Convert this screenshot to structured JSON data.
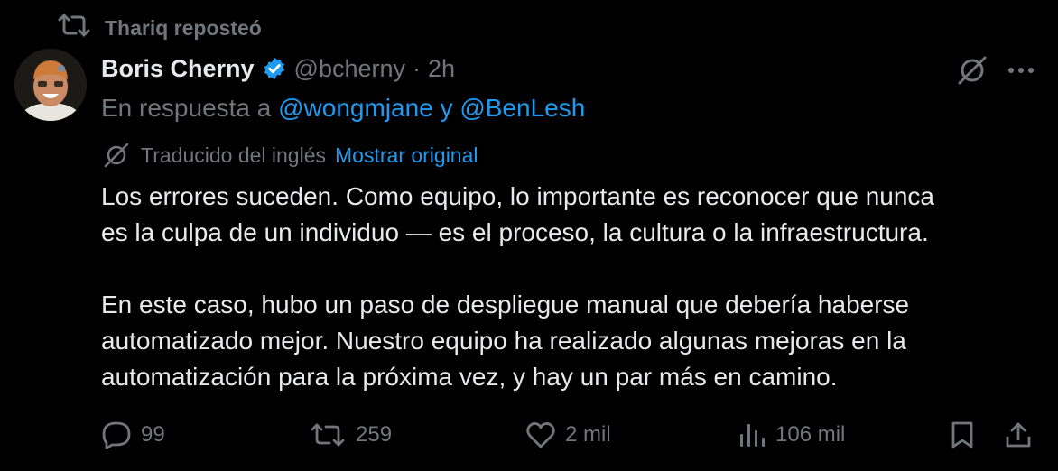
{
  "repost": {
    "label": "Thariq reposteó",
    "icon": "retweet-icon"
  },
  "author": {
    "name": "Boris Cherny",
    "verified": true,
    "verified_color": "#1d9bf0",
    "handle": "@bcherny",
    "separator": "·",
    "time": "2h"
  },
  "reply_to": {
    "prefix": "En respuesta a",
    "mention1": "@wongmjane",
    "conjunction": "y",
    "mention2": "@BenLesh"
  },
  "translation": {
    "label": "Traducido del inglés",
    "show_original": "Mostrar original"
  },
  "body": {
    "line1": "Los errores suceden. Como equipo, lo importante es reconocer que nunca",
    "line2": "es la culpa de un individuo — es el proceso, la cultura o la infraestructura.",
    "line3": "En este caso, hubo un paso de despliegue manual que debería haberse",
    "line4": "automatizado mejor. Nuestro equipo ha realizado algunas mejoras en la",
    "line5": "automatización para la próxima vez, y hay un par más en camino."
  },
  "stats": {
    "replies": "99",
    "retweets": "259",
    "likes": "2 mil",
    "views": "106 mil"
  },
  "colors": {
    "background": "#000000",
    "text": "#e7e9ea",
    "muted": "#71767b",
    "accent": "#1d9bf0"
  }
}
